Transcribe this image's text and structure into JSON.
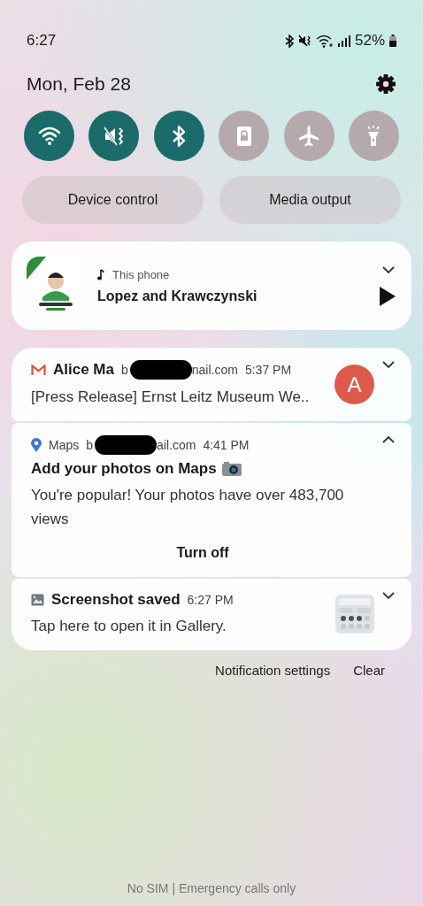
{
  "status_bar": {
    "time": "6:27",
    "battery": "52%"
  },
  "header": {
    "date": "Mon, Feb 28"
  },
  "quick_toggles": [
    {
      "kind": "wifi",
      "on": true
    },
    {
      "kind": "mute",
      "on": true
    },
    {
      "kind": "bluetooth",
      "on": true
    },
    {
      "kind": "lock",
      "on": false
    },
    {
      "kind": "airplane",
      "on": false
    },
    {
      "kind": "flashlight",
      "on": false
    }
  ],
  "quick_buttons": [
    "Device control",
    "Media output"
  ],
  "media": {
    "source": "This phone",
    "title": "Lopez and Krawczynski"
  },
  "notifications": [
    {
      "kind": "gmail",
      "app": "Alice Ma",
      "account_start": "b",
      "account_end": "nail.com",
      "time": "5:37 PM",
      "body": "[Press Release] Ernst Leitz Museum We..",
      "avatar": "A",
      "expanded": false
    },
    {
      "kind": "maps",
      "app": "Maps",
      "account_start": "b",
      "account_end": "ail.com",
      "time": "4:41 PM",
      "title": "Add your photos on Maps",
      "body": "You're popular! Your photos have over 483,700 views",
      "action": "Turn off",
      "expanded": true
    },
    {
      "kind": "screenshot",
      "app": "Screenshot saved",
      "time": "6:27 PM",
      "body": "Tap here to open it in Gallery.",
      "expanded": false
    }
  ],
  "footer_links": [
    "Notification settings",
    "Clear"
  ],
  "carrier": "No SIM | Emergency calls only"
}
